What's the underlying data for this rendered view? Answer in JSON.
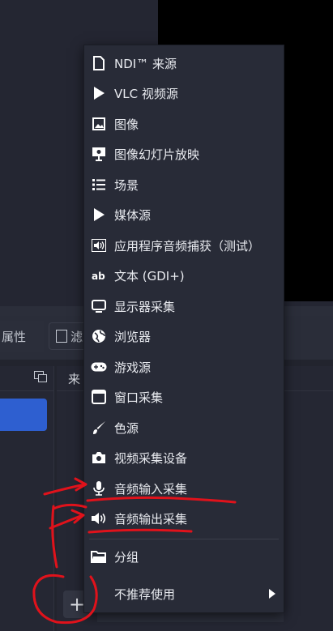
{
  "panels": {
    "properties_label": "属性",
    "filters_label": "滤",
    "sources_title": "来"
  },
  "toolbar": {
    "add_label": "+"
  },
  "menu": {
    "items": [
      {
        "label": "NDI™ 来源",
        "icon": "file-icon"
      },
      {
        "label": "VLC 视频源",
        "icon": "play-icon"
      },
      {
        "label": "图像",
        "icon": "image-icon"
      },
      {
        "label": "图像幻灯片放映",
        "icon": "slideshow-icon"
      },
      {
        "label": "场景",
        "icon": "list-icon"
      },
      {
        "label": "媒体源",
        "icon": "play-icon"
      },
      {
        "label": "应用程序音频捕获（测试）",
        "icon": "speaker-icon"
      },
      {
        "label": "文本 (GDI+)",
        "icon": "text-icon"
      },
      {
        "label": "显示器采集",
        "icon": "monitor-icon"
      },
      {
        "label": "浏览器",
        "icon": "globe-icon"
      },
      {
        "label": "游戏源",
        "icon": "gamepad-icon"
      },
      {
        "label": "窗口采集",
        "icon": "window-icon"
      },
      {
        "label": "色源",
        "icon": "brush-icon"
      },
      {
        "label": "视频采集设备",
        "icon": "camera-icon"
      },
      {
        "label": "音频输入采集",
        "icon": "microphone-icon"
      },
      {
        "label": "音频输出采集",
        "icon": "speaker-icon"
      },
      {
        "label": "分组",
        "icon": "folder-icon"
      },
      {
        "label": "不推荐使用",
        "icon": "chevron-right-icon"
      }
    ]
  },
  "colors": {
    "menu_bg": "#282b37",
    "accent_blue": "#2e5fd0",
    "annotation_red": "#e0121b"
  }
}
